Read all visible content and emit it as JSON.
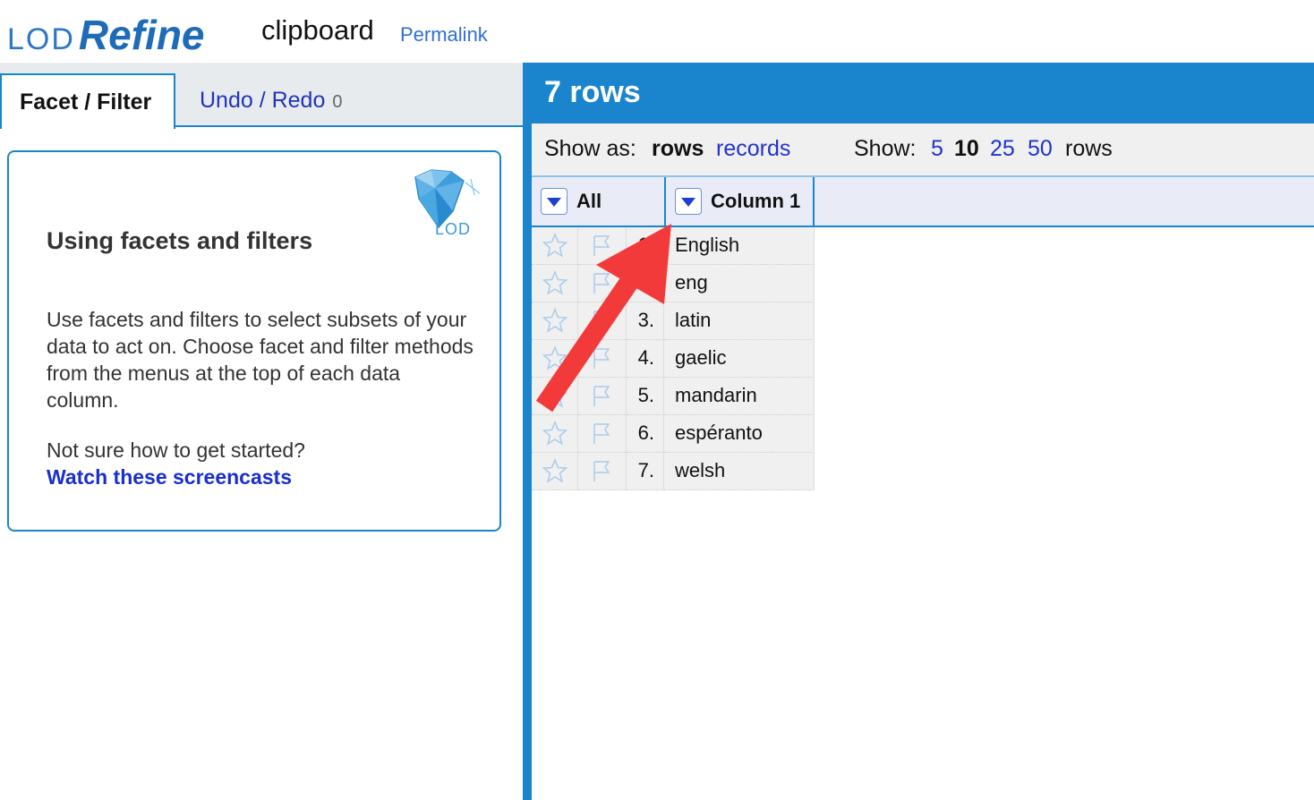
{
  "header": {
    "logo_lod": "LOD",
    "logo_refine": "Refine",
    "project_name": "clipboard",
    "permalink": "Permalink"
  },
  "left_panel": {
    "tabs": {
      "facet_filter": "Facet / Filter",
      "undo_redo": "Undo / Redo",
      "undo_count": "0"
    },
    "help": {
      "badge_text": "LOD",
      "title": "Using facets and filters",
      "body": "Use facets and filters to select subsets of your data to act on. Choose facet and filter methods from the menus at the top of each data column.",
      "question": "Not sure how to get started?",
      "link": "Watch these screencasts"
    }
  },
  "right_panel": {
    "row_count": "7 rows",
    "view_bar": {
      "show_as_label": "Show as:",
      "rows_option": "rows",
      "records_option": "records",
      "show_label": "Show:",
      "page_sizes": [
        "5",
        "10",
        "25",
        "50"
      ],
      "selected_page_size": "10",
      "rows_suffix": "rows"
    },
    "table": {
      "all_header": "All",
      "column_header": "Column 1",
      "rows": [
        {
          "num": "1.",
          "value": "English"
        },
        {
          "num": "2.",
          "value": "eng"
        },
        {
          "num": "3.",
          "value": "latin"
        },
        {
          "num": "4.",
          "value": "gaelic"
        },
        {
          "num": "5.",
          "value": "mandarin"
        },
        {
          "num": "6.",
          "value": "espéranto"
        },
        {
          "num": "7.",
          "value": "welsh"
        }
      ]
    }
  },
  "colors": {
    "accent_blue": "#1a85cc",
    "link_blue": "#2233cc",
    "annotation_red": "#f23a3a"
  }
}
